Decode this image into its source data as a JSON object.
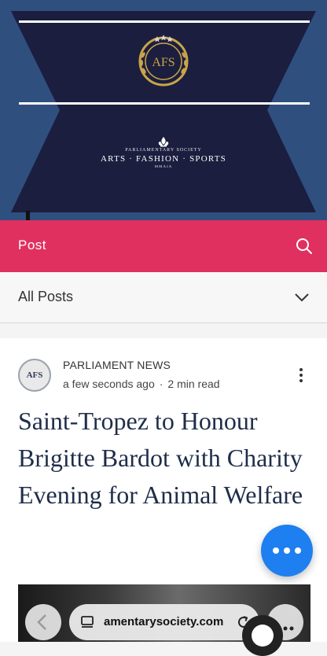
{
  "header": {
    "logo_text": "AFS",
    "org": "PARLIAMENTARY SOCIETY",
    "tagline": "ARTS · FASHION · SPORTS",
    "year": "MMXIX"
  },
  "postbar": {
    "label": "Post"
  },
  "filter": {
    "label": "All Posts"
  },
  "post": {
    "avatar_text": "AFS",
    "author": "PARLIAMENT NEWS",
    "time": "a few seconds ago",
    "separator": "·",
    "read_time": "2 min read",
    "title": "Saint-Tropez to Honour Brigitte Bardot with Charity Evening for Animal Welfare"
  },
  "browser": {
    "url": "amentarysociety.com"
  },
  "colors": {
    "accent": "#e0305f",
    "navy": "#1a1f3f",
    "blue_bg": "#2f4f7f",
    "fab": "#1e7ff0",
    "title": "#1f2d4a"
  },
  "icons": [
    "search-icon",
    "chevron-down-icon",
    "more-vertical-icon",
    "more-horizontal-icon",
    "back-icon",
    "tabs-icon",
    "reload-icon"
  ]
}
